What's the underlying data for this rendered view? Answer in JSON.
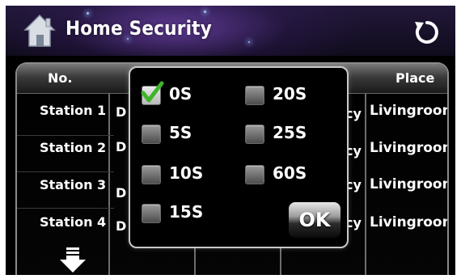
{
  "app": {
    "title": "Home Security",
    "icons": {
      "home": "home-icon",
      "refresh": "refresh-icon",
      "scroll_down": "down-arrow-icon"
    }
  },
  "table": {
    "headers": {
      "no": "No.",
      "place": "Place"
    },
    "rows": [
      {
        "station": "Station 1",
        "col2_fragment": "D",
        "col3_fragment": "cy",
        "place": "Livingroom"
      },
      {
        "station": "Station 2",
        "col2_fragment": "D",
        "col3_fragment": "cy",
        "place": "Livingroom"
      },
      {
        "station": "Station 3",
        "col2_fragment": "D",
        "col3_fragment": "cy",
        "place": "Livingroom"
      },
      {
        "station": "Station 4",
        "col2_fragment": "D",
        "col3_fragment": "cy",
        "place": "Livingroom"
      }
    ]
  },
  "delay_dialog": {
    "options": [
      {
        "label": "0S",
        "checked": true
      },
      {
        "label": "5S",
        "checked": false
      },
      {
        "label": "10S",
        "checked": false
      },
      {
        "label": "15S",
        "checked": false
      },
      {
        "label": "20S",
        "checked": false
      },
      {
        "label": "25S",
        "checked": false
      },
      {
        "label": "60S",
        "checked": false
      }
    ],
    "ok_label": "OK"
  },
  "colors": {
    "check_green": "#3fb52a",
    "background": "#000000",
    "border": "#c9c9c9"
  }
}
